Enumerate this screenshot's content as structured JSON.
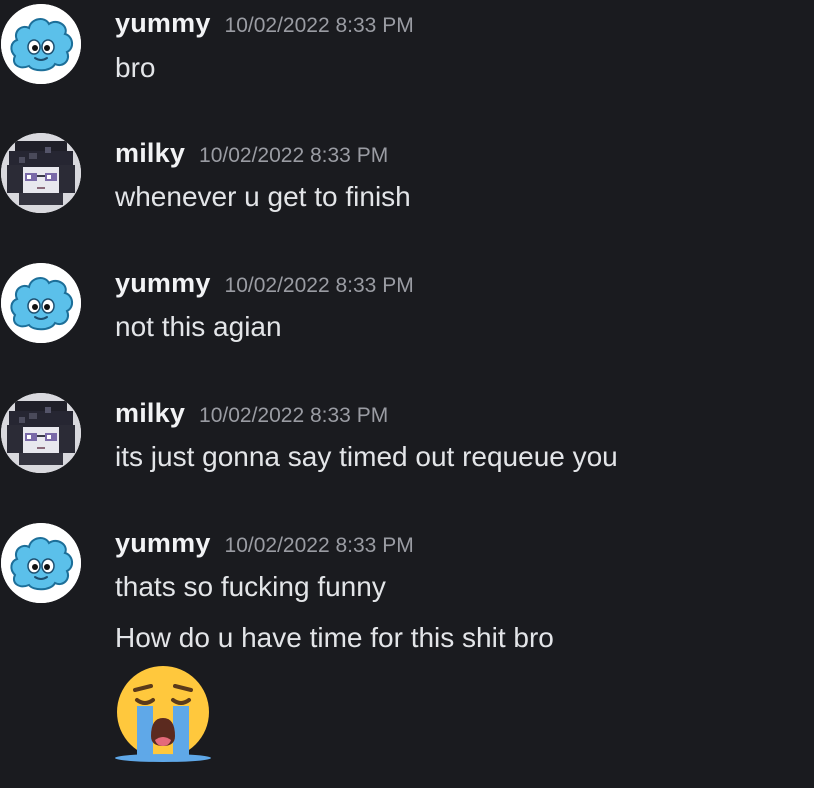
{
  "messages": [
    {
      "author": "yummy",
      "timestamp": "10/02/2022 8:33 PM",
      "avatar_icon": "blue-puffle-avatar-icon",
      "lines": [
        "bro"
      ]
    },
    {
      "author": "milky",
      "timestamp": "10/02/2022 8:33 PM",
      "avatar_icon": "pixel-anime-avatar-icon",
      "lines": [
        "whenever u get to finish"
      ]
    },
    {
      "author": "yummy",
      "timestamp": "10/02/2022 8:33 PM",
      "avatar_icon": "blue-puffle-avatar-icon",
      "lines": [
        "not this agian"
      ]
    },
    {
      "author": "milky",
      "timestamp": "10/02/2022 8:33 PM",
      "avatar_icon": "pixel-anime-avatar-icon",
      "lines": [
        "its just gonna say timed out requeue you"
      ]
    },
    {
      "author": "yummy",
      "timestamp": "10/02/2022 8:33 PM",
      "avatar_icon": "blue-puffle-avatar-icon",
      "lines": [
        "thats so fucking funny",
        "How do u have time for this shit bro"
      ],
      "emoji": "loudly-crying-face-icon"
    }
  ],
  "colors": {
    "background": "#1a1b1f",
    "author": "#f2f3f5",
    "text": "#e3e5e8",
    "timestamp": "#9a9ca3",
    "puffle_blue": "#5bc0ea",
    "emoji_yellow": "#ffc83d",
    "tears_blue": "#5fa8e8"
  }
}
